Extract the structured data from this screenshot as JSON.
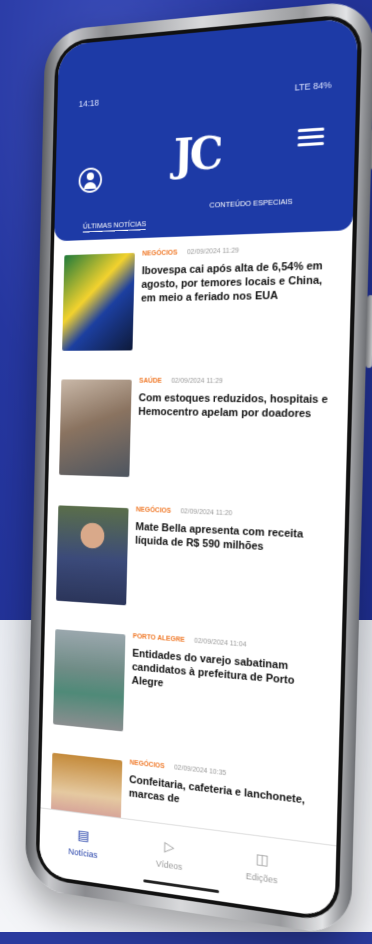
{
  "status_bar": {
    "time": "14:18",
    "right": "LTE 84%"
  },
  "header": {
    "logo": "JC",
    "tabs": [
      {
        "label": "Últimas notícias"
      },
      {
        "label": "Conteúdo Especiais"
      }
    ]
  },
  "news": [
    {
      "category": "Negócios",
      "date": "02/09/2024 11:29",
      "headline": "Ibovespa cai após alta de 6,54% em agosto, por temores locais e China, em meio a feriado nos EUA"
    },
    {
      "category": "Saúde",
      "date": "02/09/2024 11:29",
      "headline": "Com estoques reduzidos, hospitais e Hemocentro apelam por doadores"
    },
    {
      "category": "Negócios",
      "date": "02/09/2024 11:20",
      "headline": "Mate Bella apresenta com receita líquida de R$ 590 milhões"
    },
    {
      "category": "Porto Alegre",
      "date": "02/09/2024 11:04",
      "headline": "Entidades do varejo sabatinam candidatos à prefeitura de Porto Alegre"
    },
    {
      "category": "Negócios",
      "date": "02/09/2024 10:35",
      "headline": "Confeitaria, cafeteria e lanchonete, marcas de"
    }
  ],
  "bottom_nav": [
    {
      "label": "Notícias",
      "icon": "news-icon"
    },
    {
      "label": "Vídeos",
      "icon": "play-icon"
    },
    {
      "label": "Edições",
      "icon": "edition-icon"
    }
  ],
  "colors": {
    "brand_blue": "#1d3aa6",
    "category_orange": "#f07a2a"
  }
}
